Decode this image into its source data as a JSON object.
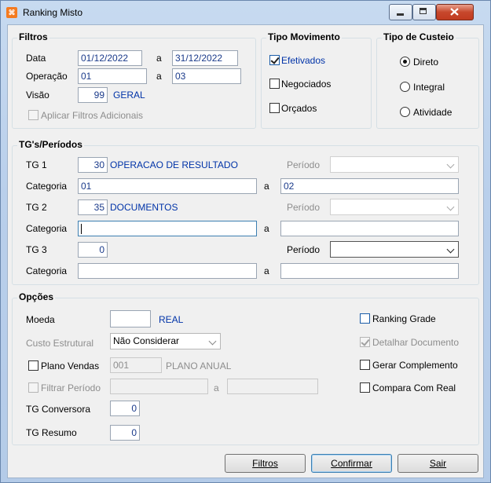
{
  "window": {
    "title": "Ranking Misto"
  },
  "filtros": {
    "legend": "Filtros",
    "data_label": "Data",
    "data_from": "01/12/2022",
    "sep_a": "a",
    "data_to": "31/12/2022",
    "operacao_label": "Operação",
    "operacao_from": "01",
    "operacao_to": "03",
    "visao_label": "Visão",
    "visao_value": "99",
    "visao_desc": "GERAL",
    "aplicar_label": "Aplicar Filtros Adicionais"
  },
  "tipo_movimento": {
    "legend": "Tipo Movimento",
    "efetivados": "Efetivados",
    "negociados": "Negociados",
    "orcados": "Orçados"
  },
  "tipo_custeio": {
    "legend": "Tipo de Custeio",
    "direto": "Direto",
    "integral": "Integral",
    "atividade": "Atividade"
  },
  "tgs": {
    "legend": "TG's/Períodos",
    "tg1_label": "TG 1",
    "tg1_value": "30",
    "tg1_desc": "OPERACAO DE RESULTADO",
    "periodo_label": "Período",
    "cat_label": "Categoria",
    "cat1_from": "01",
    "cat1_to": "02",
    "tg2_label": "TG 2",
    "tg2_value": "35",
    "tg2_desc": "DOCUMENTOS",
    "tg3_label": "TG 3",
    "tg3_value": "0",
    "sep_a": "a"
  },
  "opcoes": {
    "legend": "Opções",
    "moeda_label": "Moeda",
    "moeda_desc": "REAL",
    "custo_label": "Custo Estrutural",
    "custo_value": "Não Considerar",
    "plano_label": "Plano Vendas",
    "plano_value": "001",
    "plano_desc": "PLANO ANUAL",
    "filtrar_label": "Filtrar Período",
    "sep_a": "a",
    "tg_conv_label": "TG Conversora",
    "tg_conv_value": "0",
    "tg_resumo_label": "TG Resumo",
    "tg_resumo_value": "0",
    "ranking_grade": "Ranking Grade",
    "detalhar_doc": "Detalhar Documento",
    "gerar_comp": "Gerar Complemento",
    "compara_real": "Compara Com Real"
  },
  "buttons": {
    "filtros": "Filtros",
    "confirmar": "Confirmar",
    "sair": "Sair"
  }
}
